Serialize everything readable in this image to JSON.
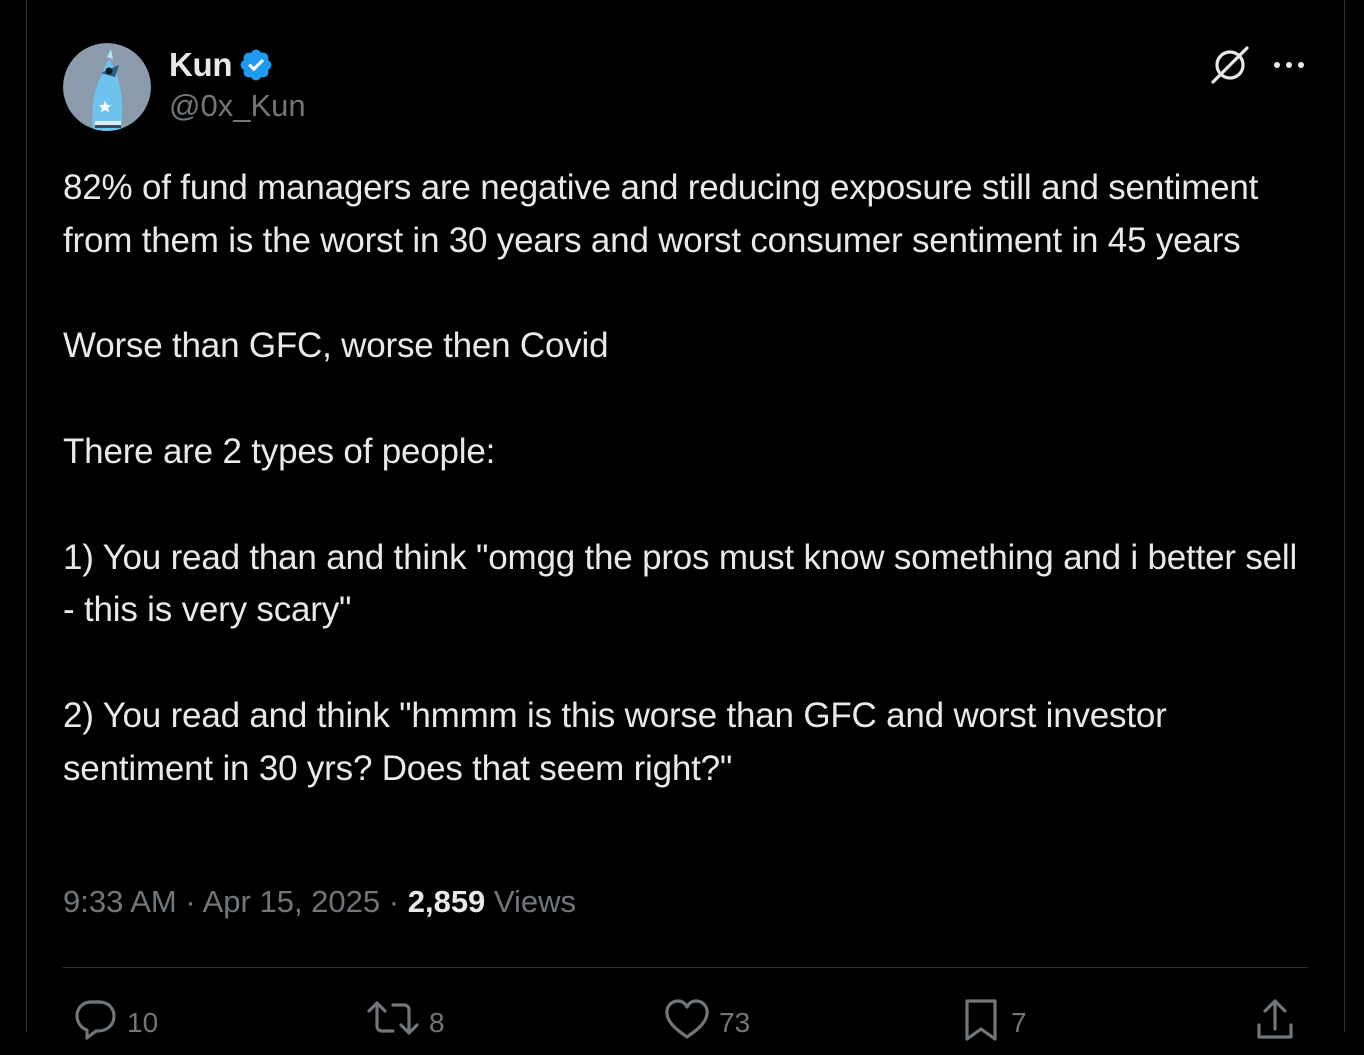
{
  "tweet": {
    "author": {
      "display_name": "Kun",
      "handle": "@0x_Kun",
      "verified": true
    },
    "body": "82% of fund managers are negative and reducing exposure still and sentiment from them is the worst in 30 years and worst consumer sentiment in 45 years\n\nWorse than GFC, worse then Covid\n\nThere are 2 types of people:\n\n1) You read than and think \"omgg the pros must know something and i better sell - this is very scary\"\n\n2) You read and think \"hmmm is this worse than GFC and worst investor sentiment in 30 yrs? Does that seem right?\"",
    "time": "9:33 AM",
    "date": "Apr 15, 2025",
    "views_count": "2,859",
    "views_label": "Views",
    "separator": "·"
  },
  "actions": {
    "reply_count": "10",
    "retweet_count": "8",
    "like_count": "73",
    "bookmark_count": "7"
  },
  "icons": {
    "verified": "verified-badge-icon",
    "grok": "grok-icon",
    "more": "more-options-icon",
    "reply": "reply-icon",
    "retweet": "retweet-icon",
    "like": "like-icon",
    "bookmark": "bookmark-icon",
    "share": "share-icon"
  },
  "colors": {
    "background": "#000000",
    "text_primary": "#e7e9ea",
    "text_secondary": "#71767b",
    "verified_blue": "#1d9bf0",
    "border": "#2f3336"
  }
}
